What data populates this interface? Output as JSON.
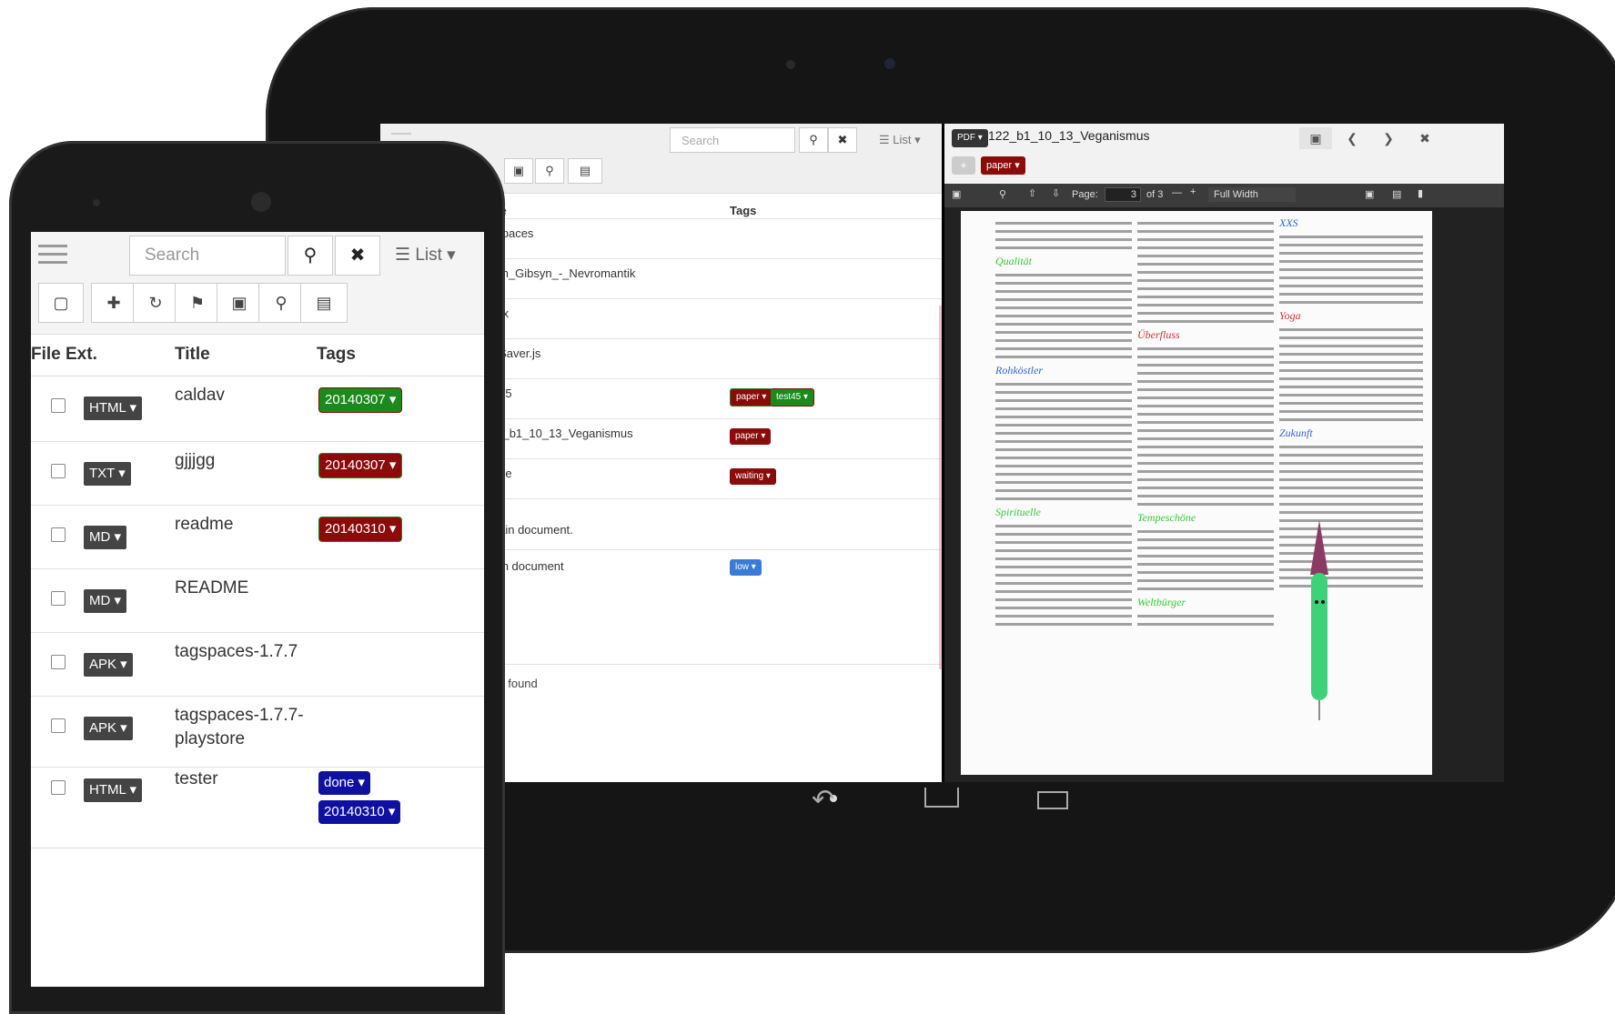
{
  "tablet": {
    "search_placeholder": "Search",
    "search_icon": "search-icon",
    "clear_icon": "close-icon",
    "view_label": "List",
    "columns": {
      "title": "itle",
      "tags": "Tags"
    },
    "rows": [
      {
        "title": "gspaces",
        "tags": []
      },
      {
        "title": "jam_Gibsyn_-_Nevromantik",
        "tags": []
      },
      {
        "title": "dex",
        "tags": []
      },
      {
        "title": "leSaver.js",
        "tags": []
      },
      {
        "title": "st45",
        "tags": [
          {
            "label": "paper",
            "color": "#8b0a0a"
          },
          {
            "label": "test45",
            "color": "#1a8a1a"
          }
        ]
      },
      {
        "title": "22_b1_10_13_Veganismus",
        "tags": [
          {
            "label": "paper",
            "color": "#8b0a0a"
          }
        ]
      },
      {
        "title": "odle",
        "tags": [
          {
            "label": "waiting",
            "color": "#8b0a0a"
          }
        ]
      },
      {
        "title": "plain document.",
        "tags": []
      },
      {
        "title": "rich document",
        "tags": [
          {
            "label": "low",
            "color": "#3a7bd5"
          }
        ]
      }
    ],
    "found_text": "les found",
    "viewer": {
      "type_badge": "PDF",
      "filename": "122_b1_10_13_Veganismus",
      "tag": "paper",
      "page_label": "Page:",
      "page_value": "3",
      "page_of": "of 3",
      "zoom": "Full Width",
      "headings": {
        "qualitat": "Qualität",
        "uberfluss": "Überfluss",
        "rohkostler": "Rohköstler",
        "spirituelle": "Spirituelle",
        "tempeschone": "Tempeschöne",
        "weltburger": "Weltbürger",
        "xxs": "XXS",
        "yoga": "Yoga",
        "zukunft": "Zukunft"
      }
    }
  },
  "phone": {
    "search_placeholder": "Search",
    "view_label": "List",
    "columns": {
      "ext": "File Ext.",
      "title": "Title",
      "tags": "Tags"
    },
    "rows": [
      {
        "ext": "HTML",
        "title": "caldav",
        "tags": [
          {
            "label": "20140307",
            "color": "#1a8a1a"
          }
        ]
      },
      {
        "ext": "TXT",
        "title": "gjjjgg",
        "tags": [
          {
            "label": "20140307",
            "color": "#8b0a0a"
          }
        ]
      },
      {
        "ext": "MD",
        "title": "readme",
        "tags": [
          {
            "label": "20140310",
            "color": "#8b0a0a"
          }
        ]
      },
      {
        "ext": "MD",
        "title": "README",
        "tags": []
      },
      {
        "ext": "APK",
        "title": "tagspaces-1.7.7",
        "tags": []
      },
      {
        "ext": "APK",
        "title": "tagspaces-1.7.7-",
        "title2": "playstore",
        "tags": []
      },
      {
        "ext": "HTML",
        "title": "tester",
        "tags": [
          {
            "label": "done",
            "color": "#1010a0"
          },
          {
            "label": "20140310",
            "color": "#1010a0"
          }
        ]
      }
    ]
  }
}
